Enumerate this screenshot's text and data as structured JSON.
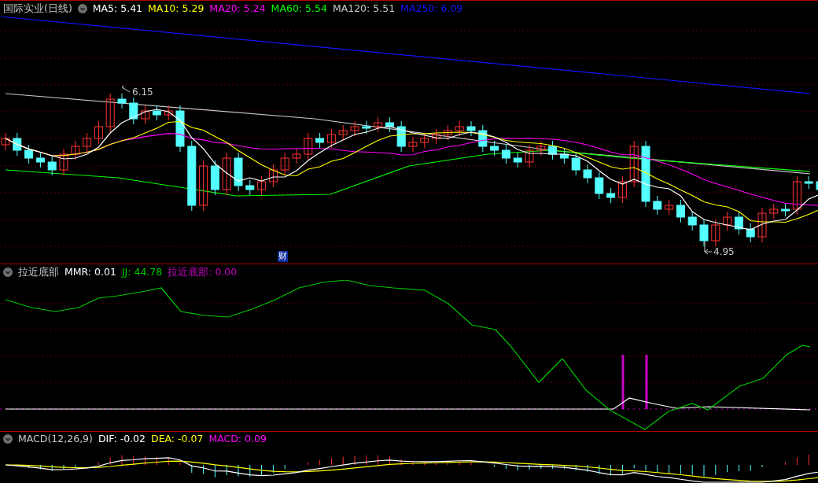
{
  "main_panel": {
    "title": "国际实业(日线)",
    "indicators": [
      {
        "label": "MA5: 5.41",
        "color": "#ffffff"
      },
      {
        "label": "MA10: 5.29",
        "color": "#ffff00"
      },
      {
        "label": "MA20: 5.24",
        "color": "#ff00ff"
      },
      {
        "label": "MA60: 5.54",
        "color": "#00ff00"
      },
      {
        "label": "MA120: 5.51",
        "color": "#c8c8c8"
      },
      {
        "label": "MA250: 6.09",
        "color": "#1414ff"
      }
    ],
    "high_label": "6.15",
    "low_label": "4.95",
    "badge": "财"
  },
  "sub_panel": {
    "title": "拉近底部",
    "indicators": [
      {
        "label": "MMR: 0.01",
        "color": "#ffffff"
      },
      {
        "label": "JJ: 44.78",
        "color": "#00c800"
      },
      {
        "label": "拉近底部: 0.00",
        "color": "#c800c8"
      }
    ]
  },
  "macd_panel": {
    "title": "MACD(12,26,9)",
    "indicators": [
      {
        "label": "DIF: -0.02",
        "color": "#ffffff"
      },
      {
        "label": "DEA: -0.07",
        "color": "#ffff00"
      },
      {
        "label": "MACD: 0.09",
        "color": "#ff00ff"
      }
    ]
  }
}
